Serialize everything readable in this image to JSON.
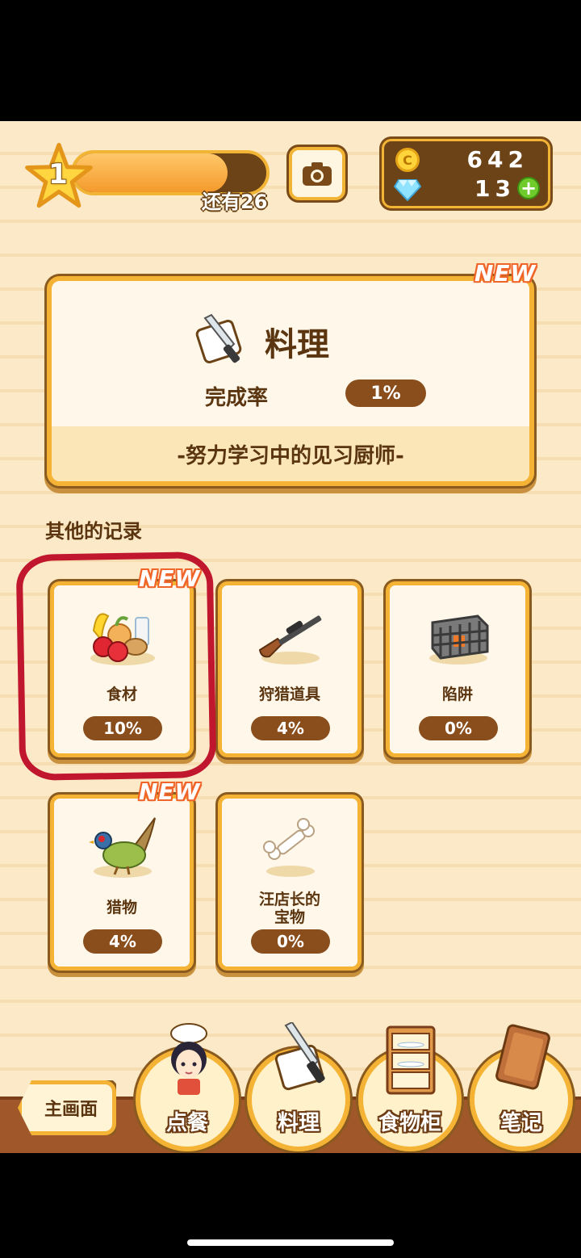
{
  "player": {
    "level": "1",
    "xp_progress": 0.8,
    "xp_remaining_text": "还有26"
  },
  "currency": {
    "coin_symbol": "C",
    "coins": "642",
    "gems": "13",
    "add_symbol": "+"
  },
  "main_record": {
    "badge": "NEW",
    "title": "料理",
    "completion_label": "完成率",
    "completion_value": "1%",
    "rank_text": "-努力学习中的见习厨师-"
  },
  "other_records": {
    "title": "其他的记录",
    "items": [
      {
        "label": "食材",
        "value": "10%",
        "badge": "NEW",
        "icon": "ingredients-icon"
      },
      {
        "label": "狩猎道具",
        "value": "4%",
        "badge": "",
        "icon": "hunting-rifle-icon"
      },
      {
        "label": "陷阱",
        "value": "0%",
        "badge": "",
        "icon": "trap-cage-icon"
      },
      {
        "label": "猎物",
        "value": "4%",
        "badge": "NEW",
        "icon": "pheasant-icon"
      },
      {
        "label": "汪店长的\n宝物",
        "value": "0%",
        "badge": "",
        "icon": "bone-icon"
      }
    ]
  },
  "nav": {
    "home_label": "主画面",
    "tabs": [
      {
        "label": "点餐",
        "icon": "chef-girl-icon"
      },
      {
        "label": "料理",
        "icon": "knife-board-icon"
      },
      {
        "label": "食物柜",
        "icon": "cupboard-icon"
      },
      {
        "label": "笔记",
        "icon": "notebook-icon"
      }
    ]
  },
  "colors": {
    "accent_orange": "#f4b335",
    "brown": "#8a4d1c",
    "highlight": "#c0162e",
    "new_badge": "#f0652a"
  }
}
